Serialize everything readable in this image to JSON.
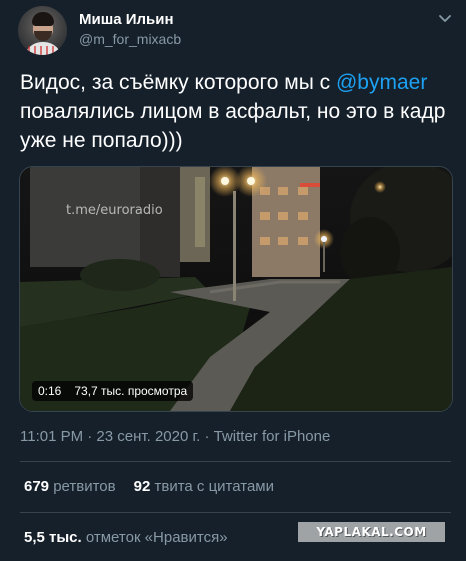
{
  "user": {
    "name": "Миша Ильин",
    "handle": "@m_for_mixacb"
  },
  "tweet": {
    "text_before": "Видос, за съёмку которого мы с",
    "mention": "@bymaer",
    "text_after": "повалялись лицом в асфальт, но это в кадр уже не попало)))"
  },
  "media": {
    "watermark": "t.me/euroradio",
    "duration": "0:16",
    "views": "73,7 тыс. просмотра"
  },
  "meta": {
    "timestamp": "11:01 PM · 23 сент. 2020 г. · Twitter for iPhone"
  },
  "stats": {
    "retweets_count": "679",
    "retweets_label": "ретвитов",
    "quotes_count": "92",
    "quotes_label": "твита с цитатами",
    "likes_count": "5,5 тыс.",
    "likes_label": "отметок «Нравится»"
  },
  "watermark_site": "YAPLAKAL.COM",
  "icons": {
    "menu": "chevron-down-icon"
  },
  "colors": {
    "background": "#15202b",
    "secondary_text": "#8899a6",
    "accent": "#1da1f2",
    "divider": "#38444d"
  }
}
